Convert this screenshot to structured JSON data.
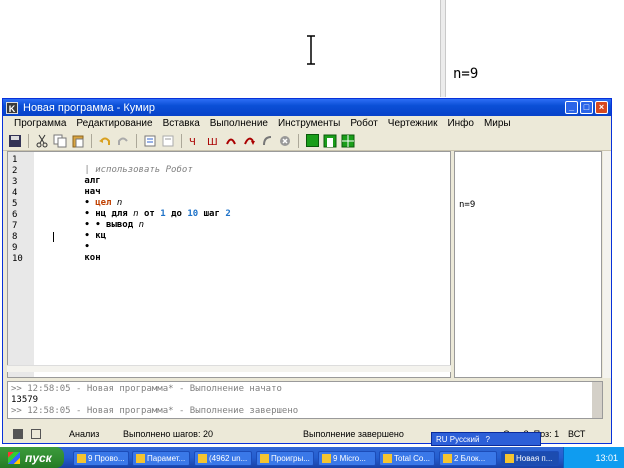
{
  "background": {
    "output_text": "n=9"
  },
  "window": {
    "title": "Новая программа - Кумир",
    "icon_letter": "K",
    "buttons": {
      "minimize": "_",
      "maximize": "□",
      "close": "×"
    }
  },
  "menu": [
    "Программа",
    "Редактирование",
    "Вставка",
    "Выполнение",
    "Инструменты",
    "Робот",
    "Чертежник",
    "Инфо",
    "Миры"
  ],
  "editor": {
    "line_numbers": [
      "1",
      "2",
      "3",
      "4",
      "5",
      "6",
      "7",
      "8",
      "9",
      "10"
    ],
    "lines": {
      "l1": {
        "bar": "|",
        "text": "использовать Робот"
      },
      "l2": {
        "kw": "алг"
      },
      "l3": {
        "kw": "нач"
      },
      "l4": {
        "dot": "•",
        "decl": "цел",
        "var": "n"
      },
      "l5": {
        "dot": "•",
        "kw1": "нц для",
        "var": "n",
        "kw2": "от",
        "n1": "1",
        "kw3": "до",
        "n2": "10",
        "kw4": "шаг",
        "n3": "2"
      },
      "l6": {
        "dot": "• •",
        "kw": "вывод",
        "var": "n"
      },
      "l7": {
        "dot": "•",
        "kw": "кц"
      },
      "l8": {
        "dot": "•"
      },
      "l9": {
        "kw": "кон"
      }
    }
  },
  "result_panel": {
    "text": "n=9"
  },
  "log": {
    "line1": ">> 12:58:05 - Новая программа* - Выполнение начато",
    "line2": "13579",
    "line3": ">> 12:58:05 - Новая программа* - Выполнение завершено"
  },
  "status": {
    "mode": "Анализ",
    "steps": "Выполнено шагов: 20",
    "state": "Выполнение завершено",
    "position": "Стр: 8, Поз: 1",
    "insert": "ВСТ"
  },
  "langbar": {
    "label": "RU Русский",
    "help": "?"
  },
  "taskbar": {
    "start": "пуск",
    "buttons": [
      "9 Прово...",
      "Парамет...",
      "(4962 un...",
      "Проигры...",
      "9 Micro...",
      "Total Co...",
      "2 Блок...",
      "Новая п..."
    ],
    "clock": "13:01"
  }
}
